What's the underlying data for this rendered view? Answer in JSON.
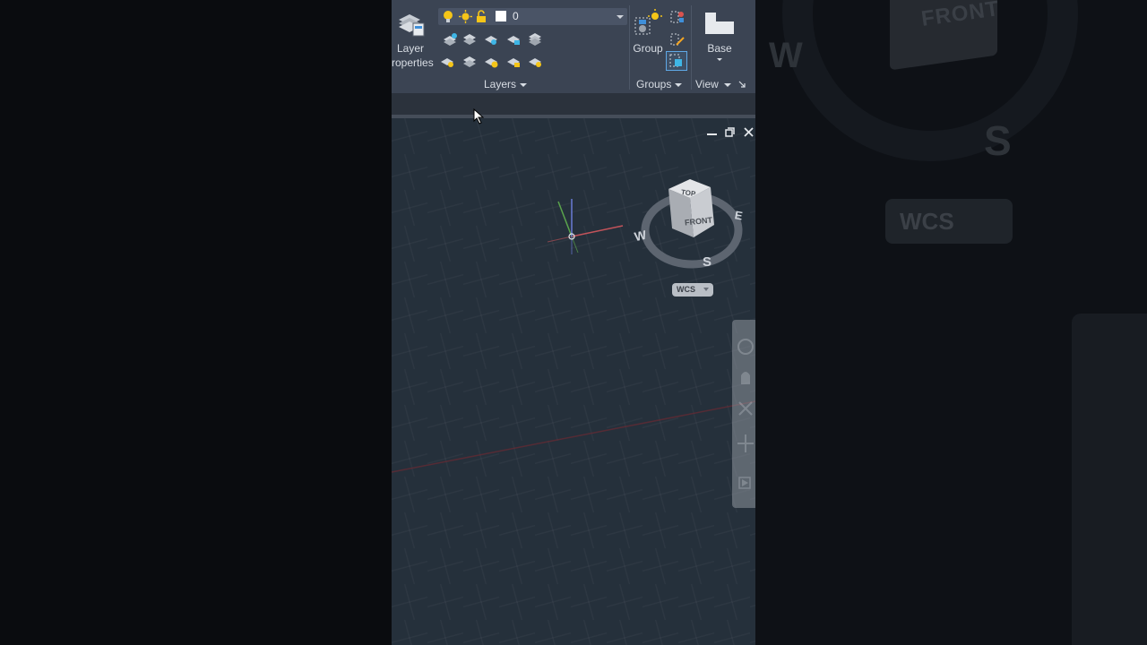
{
  "ribbon": {
    "layer_properties_line1": "Layer",
    "layer_properties_line2": "roperties",
    "current_layer": "0",
    "layers_panel": "Layers",
    "group_label": "Group",
    "groups_panel": "Groups",
    "base_label": "Base",
    "view_panel": "View"
  },
  "viewcube": {
    "top": "TOP",
    "front": "FRONT",
    "west": "W",
    "east": "E",
    "south": "S"
  },
  "ucs": {
    "label": "WCS"
  },
  "colors": {
    "ribbon_bg": "#3b4453",
    "viewport_bg": "#25303b",
    "x_axis": "#c2535a",
    "y_axis": "#5aa34c",
    "z_axis": "#6a7bd6"
  }
}
